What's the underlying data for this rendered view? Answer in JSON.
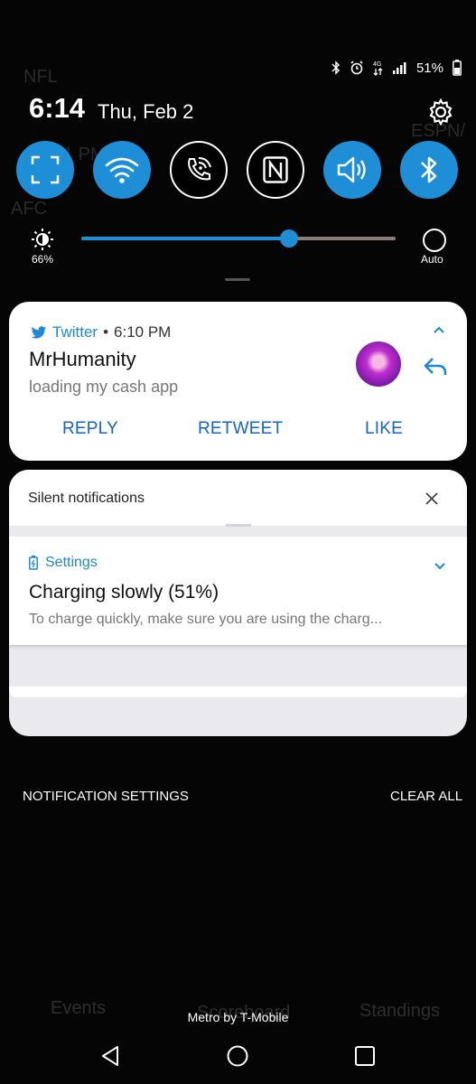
{
  "background_app": {
    "league": "NFL",
    "network": "ESPN/",
    "conference": "AFC",
    "score_fragment": "1 PM",
    "tabs": [
      "Events",
      "Scoreboard",
      "Standings"
    ]
  },
  "status_bar": {
    "battery": "51%",
    "icons": [
      "bluetooth-icon",
      "alarm-icon",
      "lte-icon",
      "signal-icon",
      "battery-icon"
    ]
  },
  "header": {
    "time": "6:14",
    "date": "Thu, Feb 2",
    "settings_icon": "gear-icon"
  },
  "quick_settings": [
    {
      "name": "screen-capture",
      "icon": "screen-capture-icon",
      "state": "on"
    },
    {
      "name": "wifi",
      "icon": "wifi-icon",
      "state": "on"
    },
    {
      "name": "wifi-calling",
      "icon": "wifi-calling-icon",
      "state": "off"
    },
    {
      "name": "nfc",
      "icon": "nfc-icon",
      "state": "off"
    },
    {
      "name": "sound",
      "icon": "volume-icon",
      "state": "on"
    },
    {
      "name": "bluetooth",
      "icon": "bluetooth-icon",
      "state": "on"
    }
  ],
  "brightness": {
    "percent_label": "66%",
    "level": 0.66,
    "auto_label": "Auto"
  },
  "twitter_notification": {
    "app": "Twitter",
    "separator": "•",
    "time": "6:10 PM",
    "title": "MrHumanity",
    "text": "loading my cash app",
    "actions": [
      "REPLY",
      "RETWEET",
      "LIKE"
    ]
  },
  "silent_section": {
    "title": "Silent notifications",
    "settings_notification": {
      "app": "Settings",
      "title": "Charging slowly (51%)",
      "text": "To charge quickly, make sure you are using the charg..."
    }
  },
  "footer": {
    "notification_settings": "NOTIFICATION SETTINGS",
    "clear_all": "CLEAR ALL",
    "carrier": "Metro by T-Mobile"
  },
  "colors": {
    "accent": "#1e8fd6",
    "action_blue": "#1565c0",
    "background": "#050505"
  }
}
